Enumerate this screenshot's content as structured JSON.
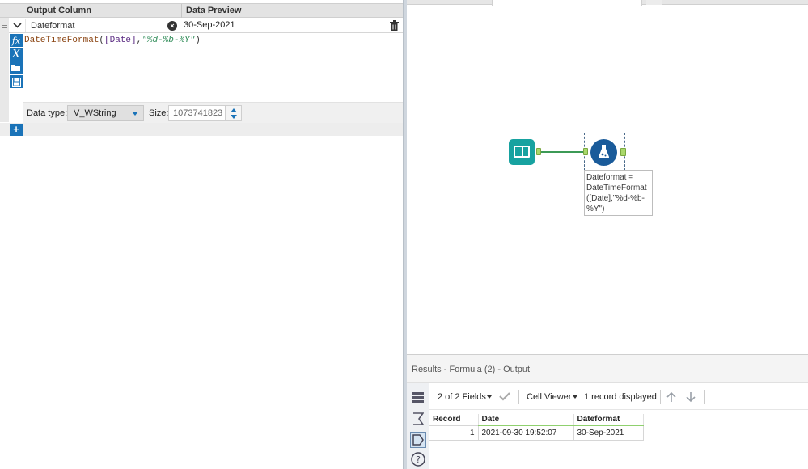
{
  "formula_panel": {
    "header": {
      "output_column": "Output Column",
      "data_preview": "Data Preview"
    },
    "row": {
      "field_name": "Dateformat",
      "preview_value": "30-Sep-2021",
      "expression": {
        "func": "DateTimeFormat",
        "open": "(",
        "field": "[Date]",
        "comma": ",",
        "string": "\"%d-%b-%Y\"",
        "close": ")"
      }
    },
    "tool_buttons": [
      "fx",
      "X"
    ],
    "data_type_label": "Data type:",
    "data_type_value": "V_WString",
    "size_label": "Size:",
    "size_value": "1073741823",
    "add_symbol": "+"
  },
  "canvas": {
    "annotation": "Dateformat = DateTimeFormat ([Date],\"%d-%b-%Y\")"
  },
  "results": {
    "title": "Results - Formula (2) - Output",
    "fields_select": "2 of 2 Fields",
    "cell_viewer": "Cell Viewer",
    "records_displayed": "1 record displayed",
    "columns": [
      "Record",
      "Date",
      "Dateformat"
    ],
    "rows": [
      {
        "record": "1",
        "date": "2021-09-30 19:52:07",
        "dateformat": "30-Sep-2021"
      }
    ]
  },
  "colors": {
    "accent_blue": "#1a73b8",
    "input_tool": "#17a2a0",
    "formula_tool": "#1a5b9a",
    "anchor_green": "#a9d86b",
    "connection": "#3c9a56"
  }
}
